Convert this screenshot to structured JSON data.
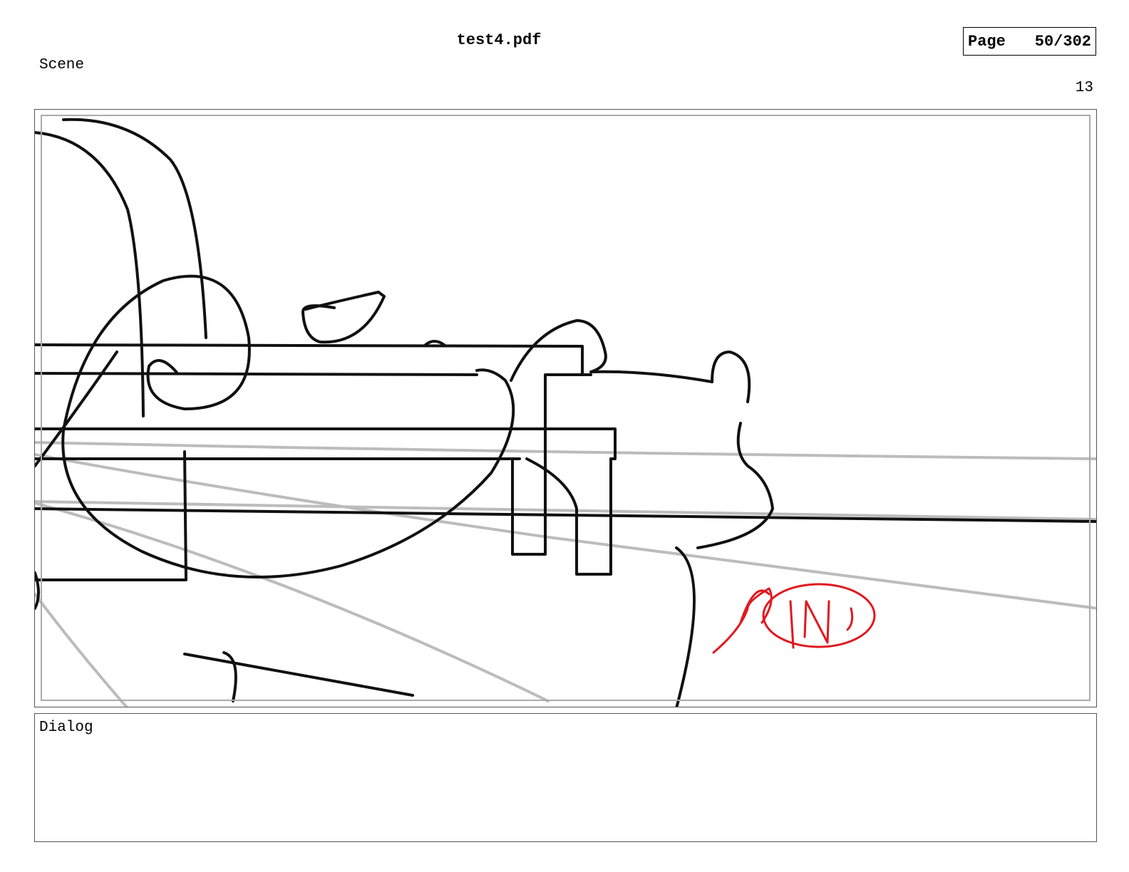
{
  "header": {
    "document_title": "test4.pdf",
    "page_label": "Page",
    "page_number": "50/302"
  },
  "scene": {
    "label": "Scene",
    "number": "13"
  },
  "panel": {
    "sketch_description_icon": "storyboard-sketch",
    "annotation_color": "#e0191e"
  },
  "dialog": {
    "label": "Dialog",
    "text": ""
  }
}
